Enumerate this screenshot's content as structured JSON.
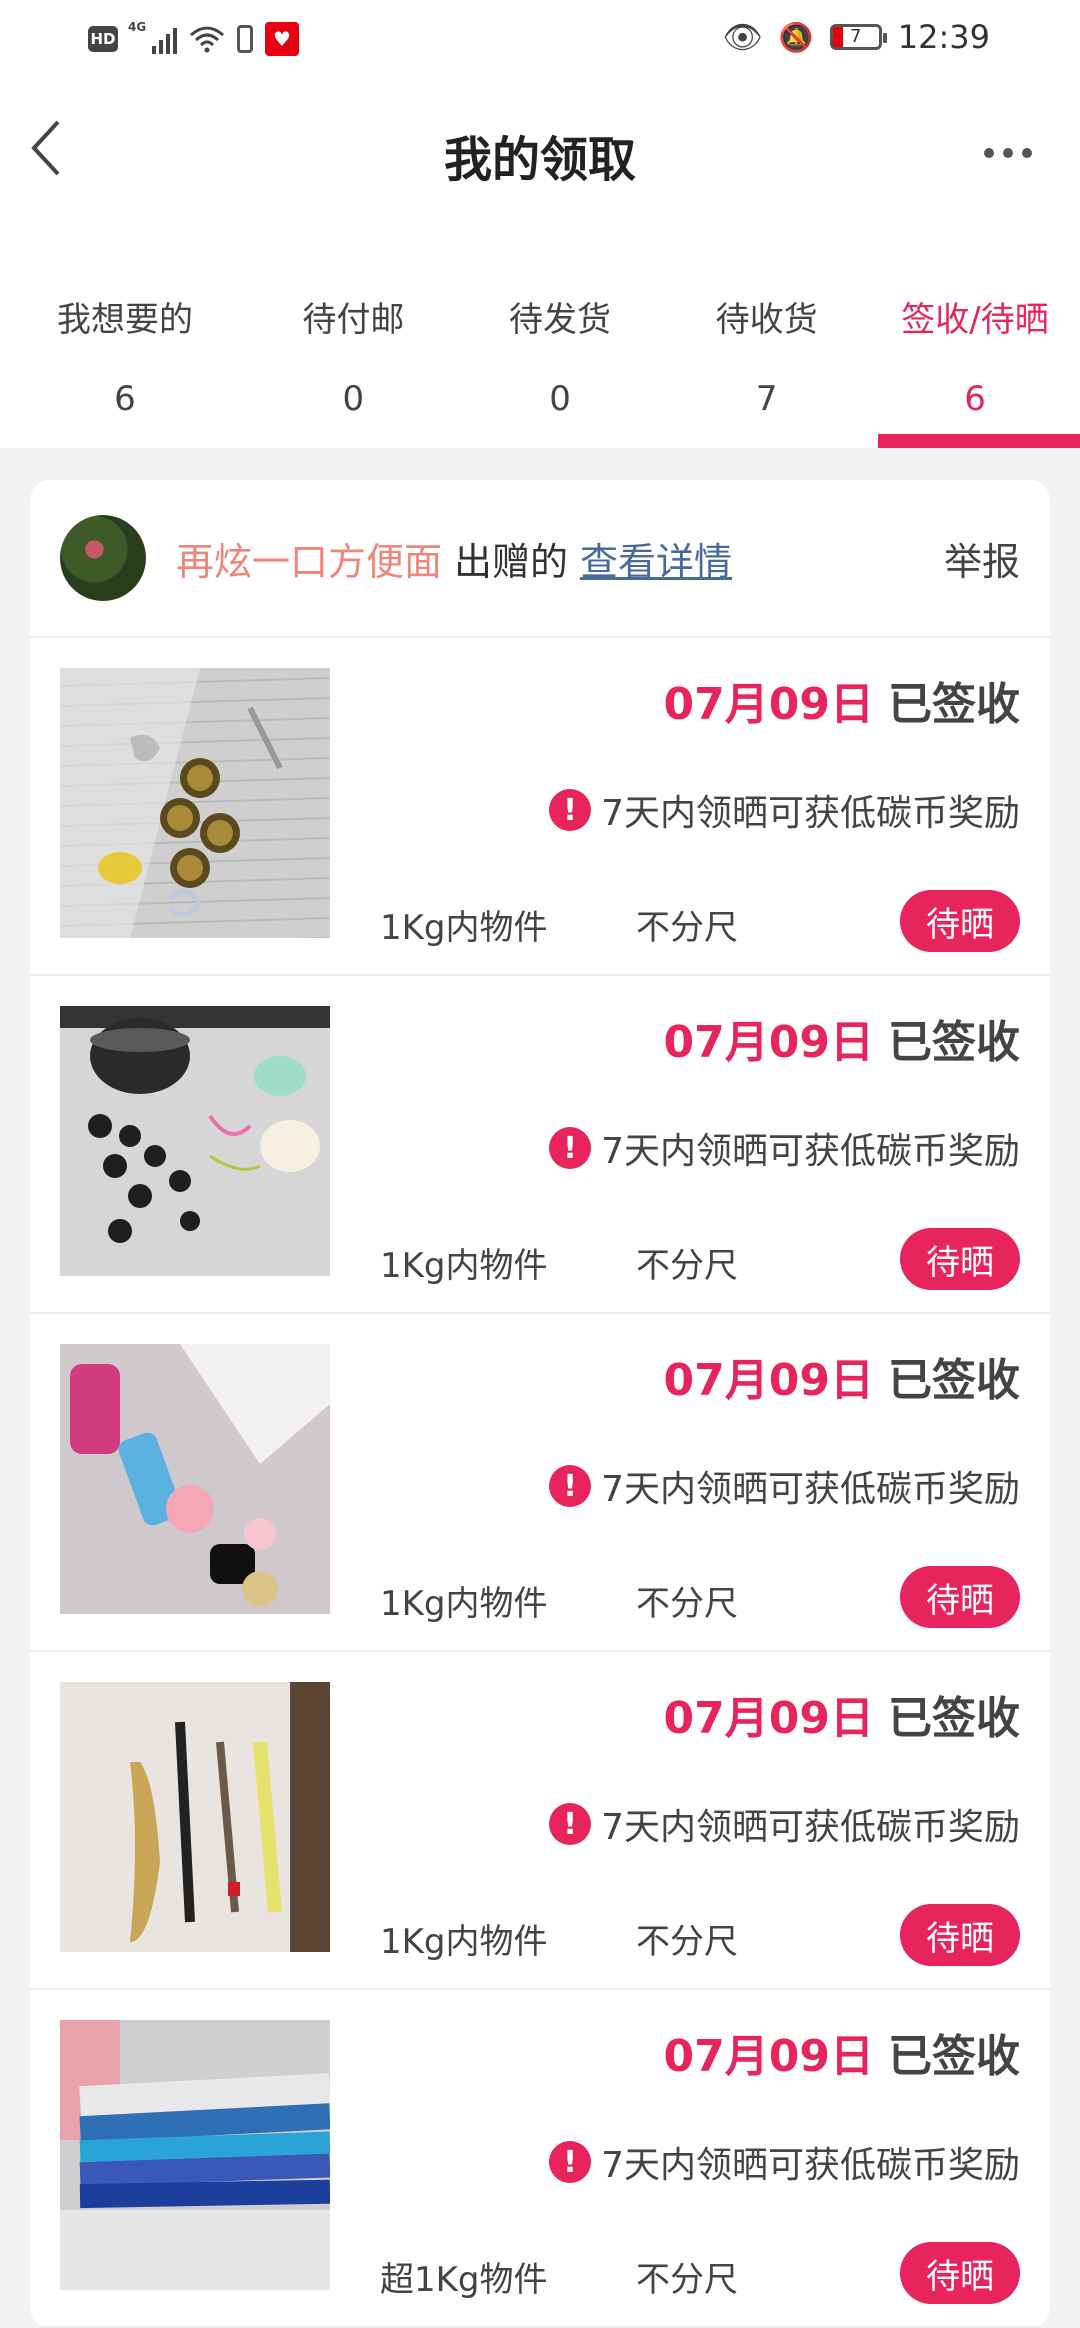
{
  "status_bar": {
    "network": "4G",
    "hd": "HD",
    "battery": "7",
    "time": "12:39"
  },
  "header": {
    "title": "我的领取"
  },
  "tabs": [
    {
      "label": "我想要的",
      "count": "6"
    },
    {
      "label": "待付邮",
      "count": "0"
    },
    {
      "label": "待发货",
      "count": "0"
    },
    {
      "label": "待收货",
      "count": "7"
    },
    {
      "label": "签收/待晒",
      "count": "6"
    }
  ],
  "donor": {
    "name": "再炫一口方便面",
    "suffix": "出赠的",
    "detail_link": "查看详情",
    "report": "举报"
  },
  "items": [
    {
      "date": "07月09日",
      "status": "已签收",
      "notice": "7天内领晒可获低碳币奖励",
      "weight": "1Kg内物件",
      "size": "不分尺",
      "action": "待晒"
    },
    {
      "date": "07月09日",
      "status": "已签收",
      "notice": "7天内领晒可获低碳币奖励",
      "weight": "1Kg内物件",
      "size": "不分尺",
      "action": "待晒"
    },
    {
      "date": "07月09日",
      "status": "已签收",
      "notice": "7天内领晒可获低碳币奖励",
      "weight": "1Kg内物件",
      "size": "不分尺",
      "action": "待晒"
    },
    {
      "date": "07月09日",
      "status": "已签收",
      "notice": "7天内领晒可获低碳币奖励",
      "weight": "1Kg内物件",
      "size": "不分尺",
      "action": "待晒"
    },
    {
      "date": "07月09日",
      "status": "已签收",
      "notice": "7天内领晒可获低碳币奖励",
      "weight": "超1Kg物件",
      "size": "不分尺",
      "action": "待晒"
    }
  ],
  "colors": {
    "accent": "#e8245c",
    "donor_name": "#f0857a",
    "link": "#4a6a9c"
  }
}
